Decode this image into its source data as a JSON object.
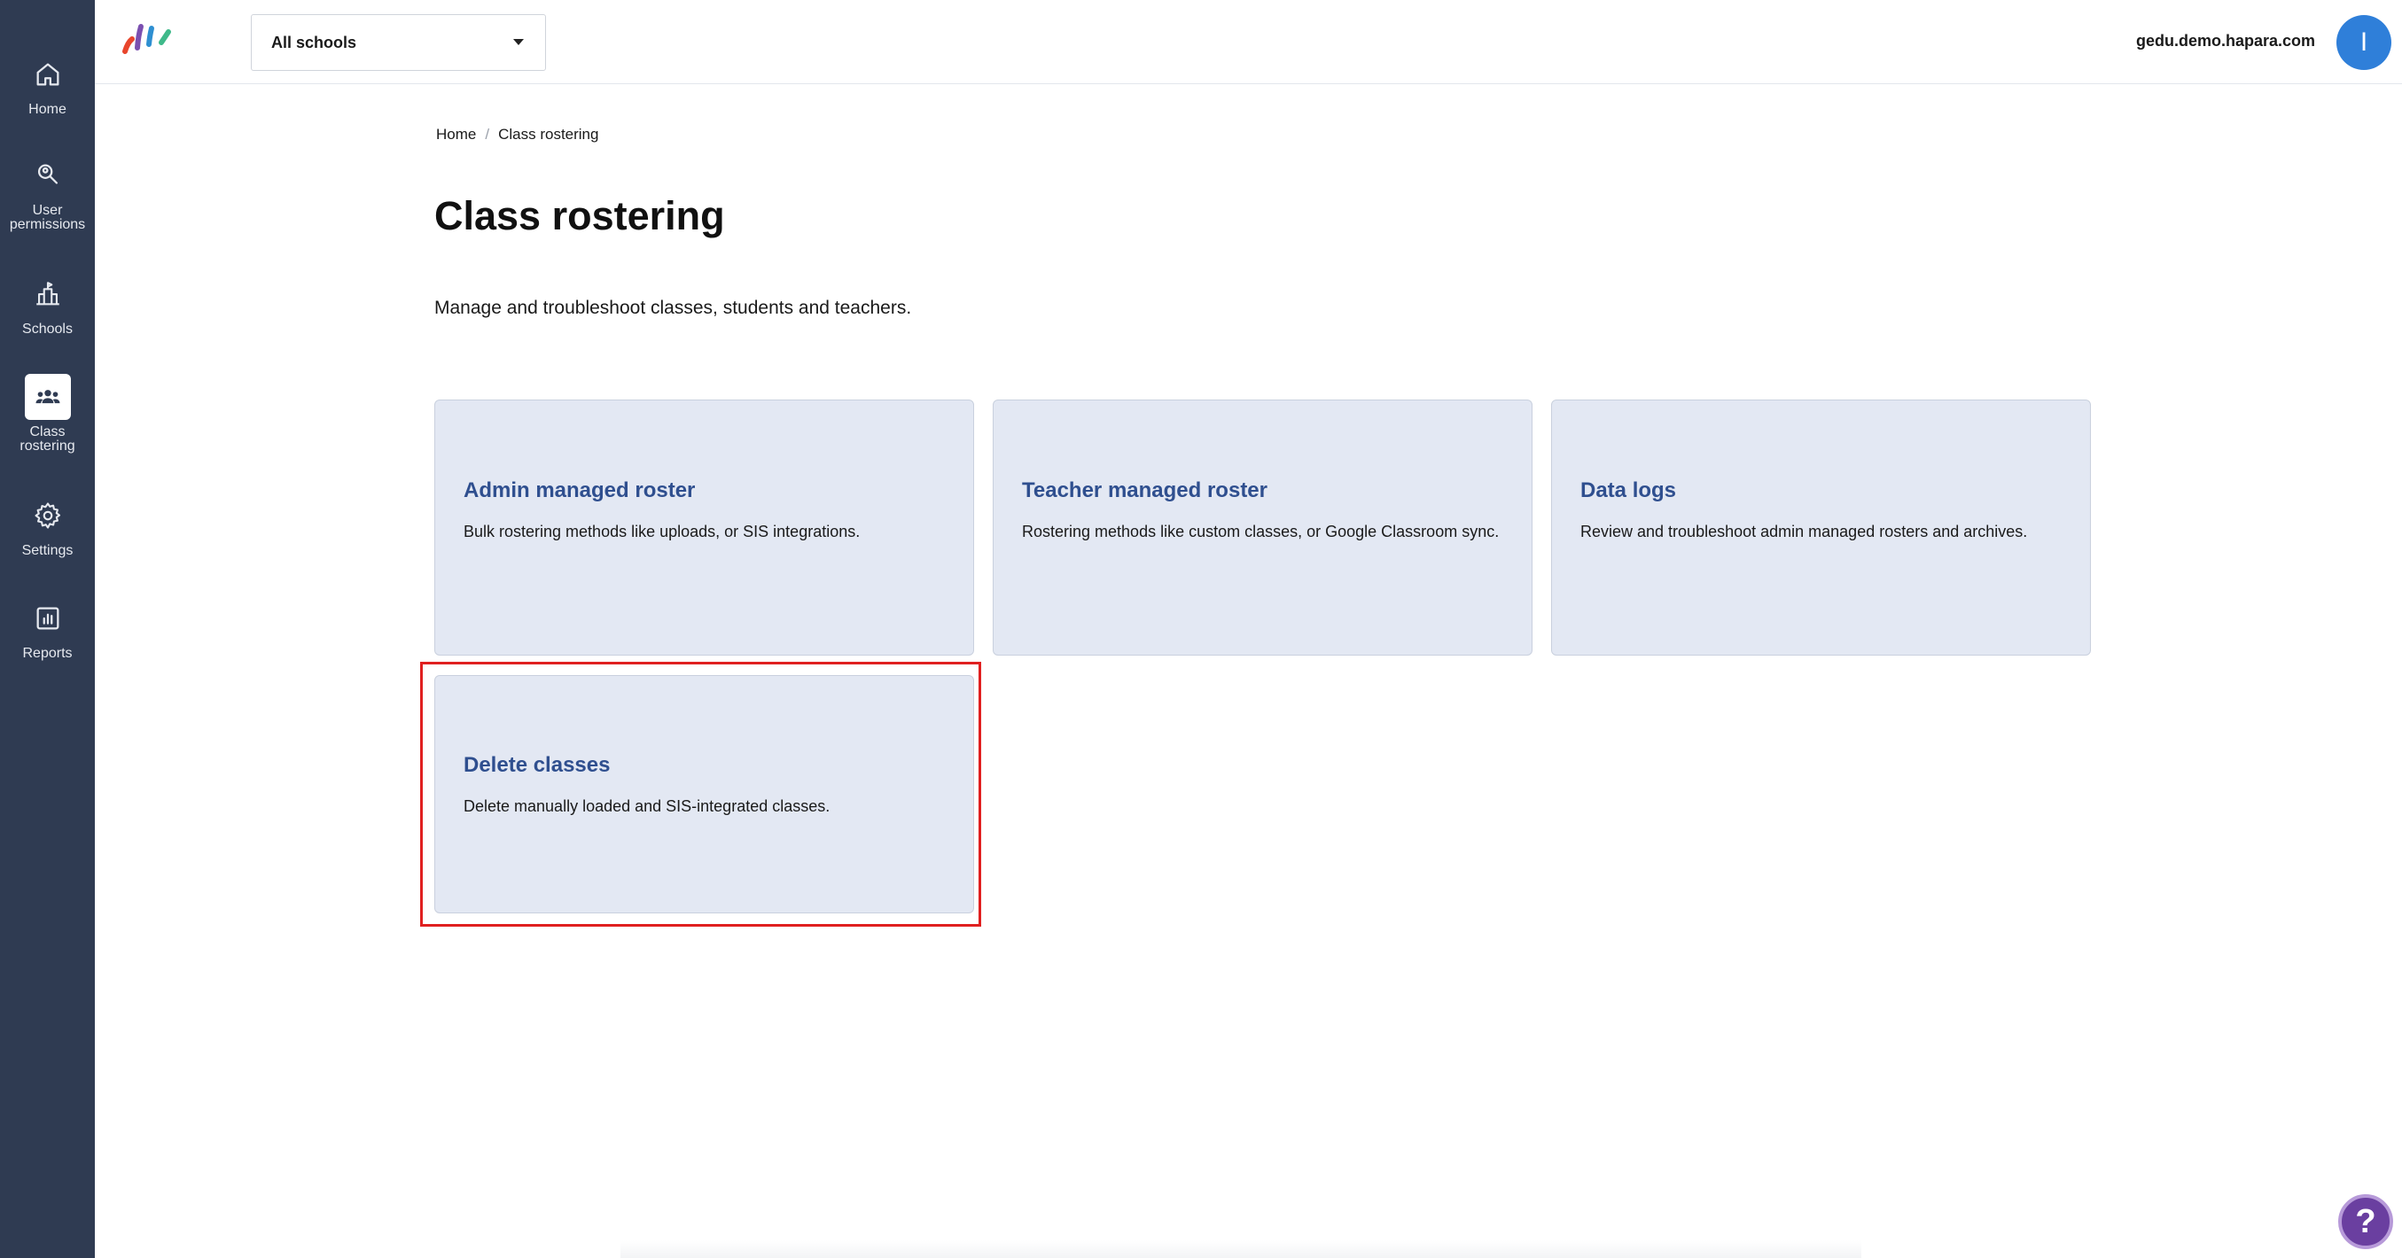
{
  "sidebar": {
    "items": [
      {
        "label": "Home",
        "icon": "home-icon"
      },
      {
        "label": "User permissions",
        "icon": "user-search-icon"
      },
      {
        "label": "Schools",
        "icon": "school-icon"
      },
      {
        "label": "Class rostering",
        "icon": "group-icon",
        "active": true
      },
      {
        "label": "Settings",
        "icon": "gear-icon"
      },
      {
        "label": "Reports",
        "icon": "chart-icon"
      }
    ]
  },
  "topbar": {
    "school_select": "All schools",
    "domain": "gedu.demo.hapara.com",
    "avatar_initial": "I"
  },
  "breadcrumb": {
    "home": "Home",
    "separator": "/",
    "current": "Class rostering"
  },
  "main": {
    "title": "Class rostering",
    "description": "Manage and troubleshoot classes, students and teachers.",
    "cards": [
      {
        "title": "Admin managed roster",
        "description": "Bulk rostering methods like uploads, or SIS integrations."
      },
      {
        "title": "Teacher managed roster",
        "description": "Rostering methods like custom classes, or Google Classroom sync."
      },
      {
        "title": "Data logs",
        "description": "Review and troubleshoot admin managed rosters and archives."
      },
      {
        "title": "Delete classes",
        "description": "Delete manually loaded and SIS-integrated classes."
      }
    ]
  },
  "help": {
    "glyph": "?"
  },
  "colors": {
    "sidebar_bg": "#2f3b52",
    "card_bg": "#e3e8f3",
    "card_title": "#2f4f8f",
    "avatar": "#2f7fd9",
    "highlight": "#e02020",
    "help": "#6a3fa0"
  }
}
